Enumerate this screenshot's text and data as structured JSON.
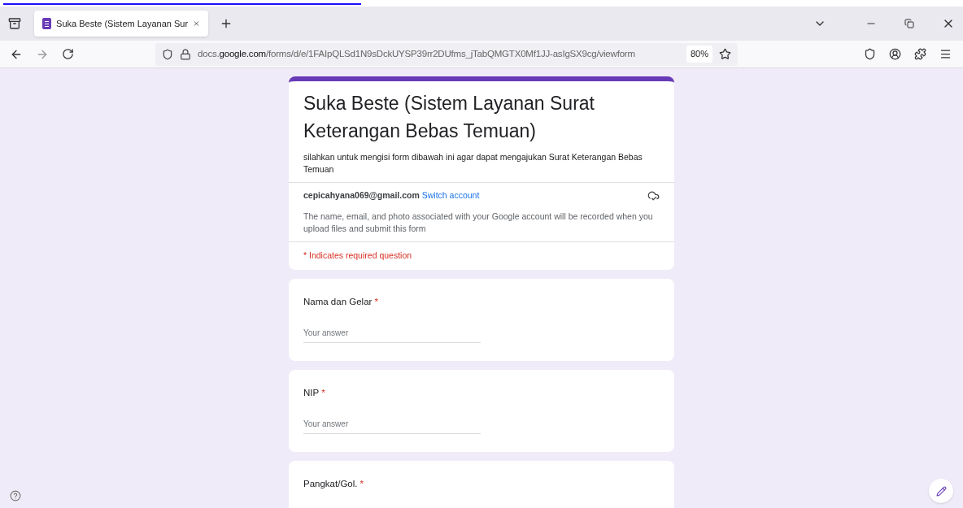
{
  "browser": {
    "tab": {
      "title": "Suka Beste (Sistem Layanan Sur",
      "selected": true
    },
    "url": {
      "host_prefix": "docs.",
      "host": "google.com",
      "path": "/forms/d/e/1FAIpQLSd1N9sDckUYSP39rr2DUfms_jTabQMGTX0Mf1JJ-asIgSX9cg/viewform"
    },
    "zoom": "80%"
  },
  "form": {
    "title": "Suka Beste (Sistem Layanan Surat Keterangan Bebas Temuan)",
    "description": "silahkan untuk mengisi form dibawah ini agar dapat mengajukan Surat Keterangan Bebas Temuan",
    "email": "cepicahyana069@gmail.com",
    "switch_account": "Switch account",
    "notice": "The name, email, and photo associated with your Google account will be recorded when you upload files and submit this form",
    "required_note": "* Indicates required question"
  },
  "questions": [
    {
      "label": "Nama dan Gelar",
      "required": true,
      "required_mark": "*",
      "placeholder": "Your answer"
    },
    {
      "label": "NIP",
      "required": true,
      "required_mark": "*",
      "placeholder": "Your answer"
    },
    {
      "label": "Pangkat/Gol.",
      "required": true,
      "required_mark": "*"
    }
  ]
}
